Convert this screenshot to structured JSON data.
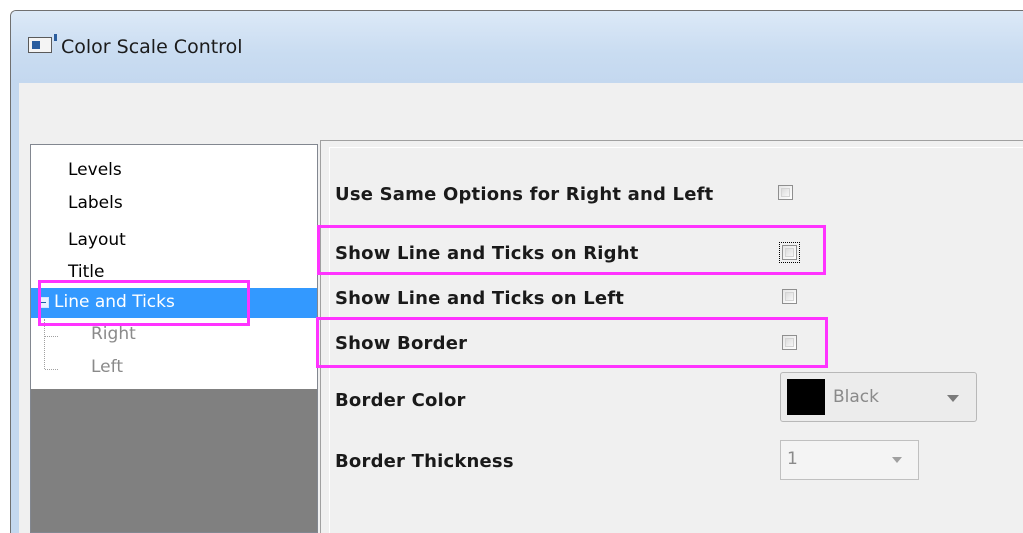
{
  "window": {
    "title": "Color Scale Control"
  },
  "tree": {
    "items": [
      {
        "label": "Levels"
      },
      {
        "label": "Labels"
      },
      {
        "label": "Layout"
      },
      {
        "label": "Title"
      },
      {
        "label": "Line and Ticks",
        "selected": true,
        "expanded": true
      },
      {
        "label": "Right",
        "child": true
      },
      {
        "label": "Left",
        "child": true
      }
    ]
  },
  "options": {
    "same_options": {
      "label": "Use Same Options for Right and Left",
      "checked": false
    },
    "show_right": {
      "label": "Show Line and Ticks on Right",
      "checked": false
    },
    "show_left": {
      "label": "Show Line and Ticks on Left",
      "checked": false
    },
    "show_border": {
      "label": "Show Border",
      "checked": false
    },
    "border_color": {
      "label": "Border Color",
      "value": "Black",
      "swatch": "#000000"
    },
    "border_thickness": {
      "label": "Border Thickness",
      "value": "1"
    }
  },
  "colors": {
    "highlight": "#ff33ff",
    "selection": "#3399ff"
  }
}
